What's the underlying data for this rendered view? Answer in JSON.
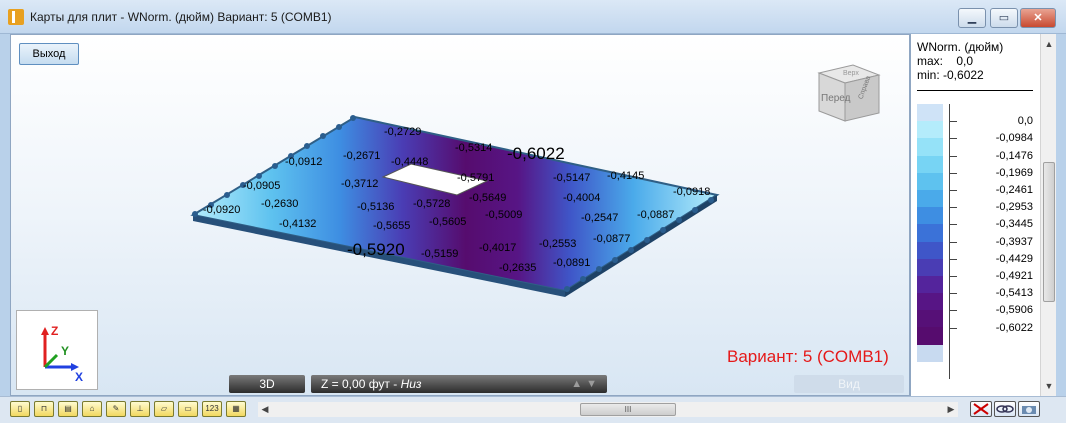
{
  "window": {
    "title": "Карты для плит - WNorm. (дюйм) Вариант: 5 (COMB1)",
    "minimize": "▁",
    "maximize": "▭",
    "close": "✕"
  },
  "viewport": {
    "exit_button": "Выход",
    "view_mode": "3D",
    "z_level_prefix": "Z = 0,00 фут - ",
    "z_level_suffix": "Низ",
    "view_button": "Вид",
    "variant_label": "Вариант: 5 (COMB1)",
    "viewcube": {
      "front": "Перед",
      "right": "Справа",
      "top": "Верх"
    },
    "axes": {
      "z": "Z",
      "y": "Y",
      "x": "X"
    }
  },
  "plate_labels": [
    "-0,2729",
    "-0,5314",
    "-0,6022",
    "-0,0912",
    "-0,2671",
    "-0,4448",
    "-0,5791",
    "-0,5147",
    "-0,4145",
    "-0,0905",
    "-0,3712",
    "-0,5649",
    "-0,4004",
    "-0,0918",
    "-0,0920",
    "-0,2630",
    "-0,5136",
    "-0,5728",
    "-0,5009",
    "-0,2547",
    "-0,0887",
    "-0,4132",
    "-0,5655",
    "-0,5605",
    "-0,0877",
    "-0,4017",
    "-0,2553",
    "-0,5920",
    "-0,5159",
    "-0,0891",
    "-0,2635"
  ],
  "legend": {
    "title": "WNorm. (дюйм)",
    "max_label": "max:",
    "max_value": "0,0",
    "min_label": "min:",
    "min_value": "-0,6022",
    "values": [
      "0,0",
      "-0,0984",
      "-0,1476",
      "-0,1969",
      "-0,2461",
      "-0,2953",
      "-0,3445",
      "-0,3937",
      "-0,4429",
      "-0,4921",
      "-0,5413",
      "-0,5906",
      "-0,6022"
    ],
    "colors": [
      "#cfe3f7",
      "#b4ecfb",
      "#95e2f8",
      "#77d4f4",
      "#5ec2ef",
      "#4aaaea",
      "#3e8ee2",
      "#3b72d8",
      "#3f56c8",
      "#4a3db4",
      "#54249c",
      "#571585",
      "#561077",
      "#560c6e",
      "#c8daf0"
    ]
  },
  "toolbar": {
    "icons": [
      "slab-icon",
      "grid-icon",
      "dims-icon",
      "load-icon",
      "pen-icon",
      "beam-icon",
      "panel-icon",
      "area-icon",
      "numbers-icon",
      "table-icon"
    ],
    "icon_glyphs": [
      "▯",
      "⊓",
      "▤",
      "⌂",
      "✎",
      "⊥",
      "▱",
      "▭",
      "123",
      "▦"
    ],
    "scroll_thumb": "III"
  }
}
